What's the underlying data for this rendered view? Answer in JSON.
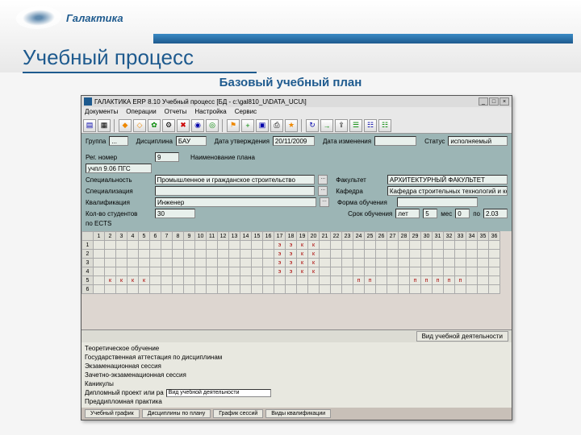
{
  "slide": {
    "logo_text": "Галактика",
    "title": "Учебный процесс",
    "subtitle": "Базовый учебный план"
  },
  "titlebar": {
    "app": "ГАЛАКТИКА ERP",
    "ver": "8.10",
    "module": "Учебный процесс",
    "db": "[БД - c:\\gal810_U\\DATA_UCU\\]"
  },
  "menu": [
    "Документы",
    "Операции",
    "Отчеты",
    "Настройка",
    "Сервис"
  ],
  "top_form": {
    "group_l": "Группа",
    "group_v": "...",
    "disc_l": "Дисциплина",
    "disc_v": "БАУ",
    "date_l": "Дата утверждения",
    "date_v": "20/11/2009",
    "change_l": "Дата изменения",
    "change_v": "",
    "status_l": "Статус",
    "status_v": "исполняемый"
  },
  "main_form": {
    "reg_l": "Рег. номер",
    "reg_v": "9",
    "name_l": "Наименование плана",
    "name_v": "учпл 9.06 ПГС",
    "spec_l": "Специальность",
    "spec_v": "Промышленное и гражданское строительство",
    "fac_l": "Факультет",
    "fac_v": "АРХИТЕКТУРНЫЙ ФАКУЛЬТЕТ",
    "splz_l": "Специализация",
    "splz_v": "",
    "kaf_l": "Кафедра",
    "kaf_v": "Кафедра строительных технологий и конст.",
    "qual_l": "Квалификация",
    "qual_v": "Инженер",
    "form_l": "Форма обучения",
    "form_v": "",
    "cnt_l": "Кол-во студентов",
    "cnt_v": "30",
    "term_l": "Срок обучения",
    "term_v": "лет",
    "term_n1": "5",
    "term_mid": "мес",
    "term_n2": "0",
    "term_po": "по",
    "term_end": "2.03",
    "ects_l": "по ECTS"
  },
  "grid": {
    "rows": 6,
    "cols": 36,
    "marks": {
      "1": {
        "17": "э",
        "18": "э",
        "19": "к",
        "20": "к"
      },
      "2": {
        "17": "э",
        "18": "э",
        "19": "к",
        "20": "к"
      },
      "3": {
        "17": "э",
        "18": "э",
        "19": "к",
        "20": "к"
      },
      "4": {
        "17": "э",
        "18": "э",
        "19": "к",
        "20": "к"
      },
      "5": {
        "2": "к",
        "3": "к",
        "4": "к",
        "5": "к",
        "24": "п",
        "25": "п",
        "29": "п",
        "30": "п",
        "31": "п",
        "32": "п",
        "33": "п"
      }
    }
  },
  "lower": {
    "btn": "Вид учебной деятельности",
    "items": [
      "Теоретическое обучение",
      "Государственная аттестация по дисциплинам",
      "Экзаменационная сессия",
      "Зачетно-экзаменационная сессия",
      "Каникулы"
    ],
    "sel_label": "Дипломный проект или ра",
    "sel_val": "Вид учебной деятельности",
    "after": "Преддипломная практика"
  },
  "tabs": [
    "Учебный график",
    "Дисциплины по плану",
    "График сессий",
    "Виды квалификации"
  ]
}
